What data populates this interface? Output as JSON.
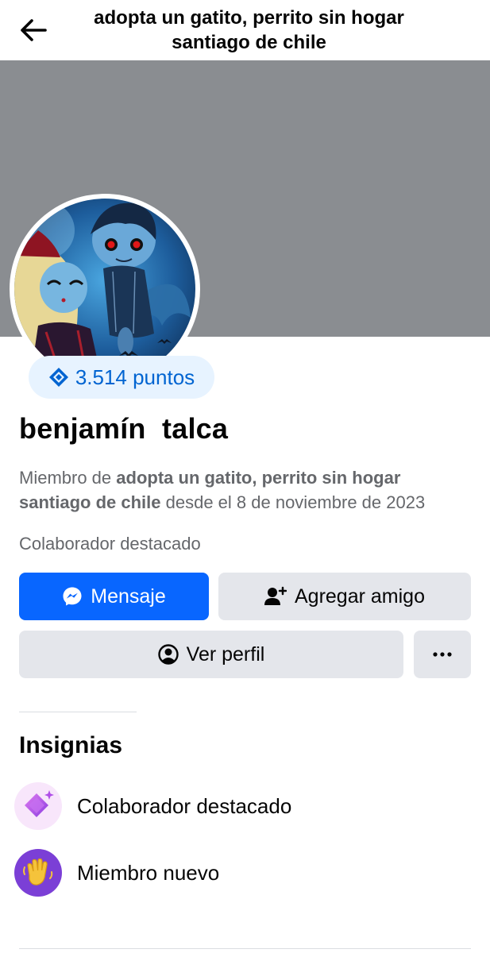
{
  "header": {
    "group_title_line1": "adopta un gatito, perrito sin hogar",
    "group_title_line2": "santiago de chile",
    "back_icon": "arrow-left-icon"
  },
  "cover": {
    "color": "#8a8d91"
  },
  "profile": {
    "points_label": "3.514 puntos",
    "points_icon": "diamond-points-icon",
    "name": "benjamín  talca",
    "member_prefix": "Miembro de ",
    "member_group": "adopta un gatito, perrito sin hogar santiago de chile",
    "member_suffix": " desde el 8 de noviembre de 2023",
    "role": "Colaborador destacado"
  },
  "actions": {
    "message_label": "Mensaje",
    "add_friend_label": "Agregar amigo",
    "view_profile_label": "Ver perfil",
    "more_icon": "more-dots-icon"
  },
  "badges": {
    "title": "Insignias",
    "items": [
      {
        "label": "Colaborador destacado",
        "icon": "sparkle-diamond-icon"
      },
      {
        "label": "Miembro nuevo",
        "icon": "waving-hand-icon"
      }
    ]
  },
  "colors": {
    "primary": "#0866ff",
    "secondary_button": "#e4e6eb",
    "points_bg": "#e7f3ff",
    "points_text": "#0064d1",
    "muted_text": "#65676b"
  }
}
